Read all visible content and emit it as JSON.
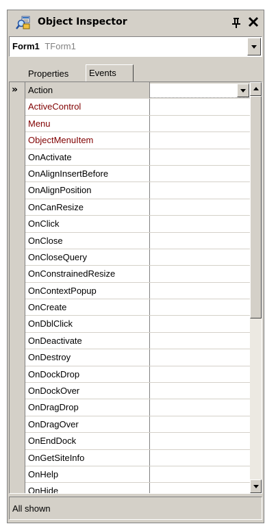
{
  "window": {
    "title": "Object Inspector",
    "pin_icon": "pin-icon",
    "close_icon": "close-icon",
    "title_icon": "object-inspector-icon"
  },
  "object_selector": {
    "name": "Form1",
    "type": "TForm1"
  },
  "tabs": [
    {
      "label": "Properties",
      "active": false
    },
    {
      "label": "Events",
      "active": true
    }
  ],
  "events": [
    {
      "name": "Action",
      "value": "",
      "selected": true,
      "highlight": false
    },
    {
      "name": "ActiveControl",
      "value": "",
      "selected": false,
      "highlight": true
    },
    {
      "name": "Menu",
      "value": "",
      "selected": false,
      "highlight": true
    },
    {
      "name": "ObjectMenuItem",
      "value": "",
      "selected": false,
      "highlight": true
    },
    {
      "name": "OnActivate",
      "value": "",
      "selected": false,
      "highlight": false
    },
    {
      "name": "OnAlignInsertBefore",
      "value": "",
      "selected": false,
      "highlight": false
    },
    {
      "name": "OnAlignPosition",
      "value": "",
      "selected": false,
      "highlight": false
    },
    {
      "name": "OnCanResize",
      "value": "",
      "selected": false,
      "highlight": false
    },
    {
      "name": "OnClick",
      "value": "",
      "selected": false,
      "highlight": false
    },
    {
      "name": "OnClose",
      "value": "",
      "selected": false,
      "highlight": false
    },
    {
      "name": "OnCloseQuery",
      "value": "",
      "selected": false,
      "highlight": false
    },
    {
      "name": "OnConstrainedResize",
      "value": "",
      "selected": false,
      "highlight": false
    },
    {
      "name": "OnContextPopup",
      "value": "",
      "selected": false,
      "highlight": false
    },
    {
      "name": "OnCreate",
      "value": "",
      "selected": false,
      "highlight": false
    },
    {
      "name": "OnDblClick",
      "value": "",
      "selected": false,
      "highlight": false
    },
    {
      "name": "OnDeactivate",
      "value": "",
      "selected": false,
      "highlight": false
    },
    {
      "name": "OnDestroy",
      "value": "",
      "selected": false,
      "highlight": false
    },
    {
      "name": "OnDockDrop",
      "value": "",
      "selected": false,
      "highlight": false
    },
    {
      "name": "OnDockOver",
      "value": "",
      "selected": false,
      "highlight": false
    },
    {
      "name": "OnDragDrop",
      "value": "",
      "selected": false,
      "highlight": false
    },
    {
      "name": "OnDragOver",
      "value": "",
      "selected": false,
      "highlight": false
    },
    {
      "name": "OnEndDock",
      "value": "",
      "selected": false,
      "highlight": false
    },
    {
      "name": "OnGetSiteInfo",
      "value": "",
      "selected": false,
      "highlight": false
    },
    {
      "name": "OnHelp",
      "value": "",
      "selected": false,
      "highlight": false
    },
    {
      "name": "OnHide",
      "value": "",
      "selected": false,
      "highlight": false
    }
  ],
  "selected_indicator": "»",
  "status": "All shown",
  "colors": {
    "highlight_text": "#800000",
    "face": "#d4d0c8"
  }
}
